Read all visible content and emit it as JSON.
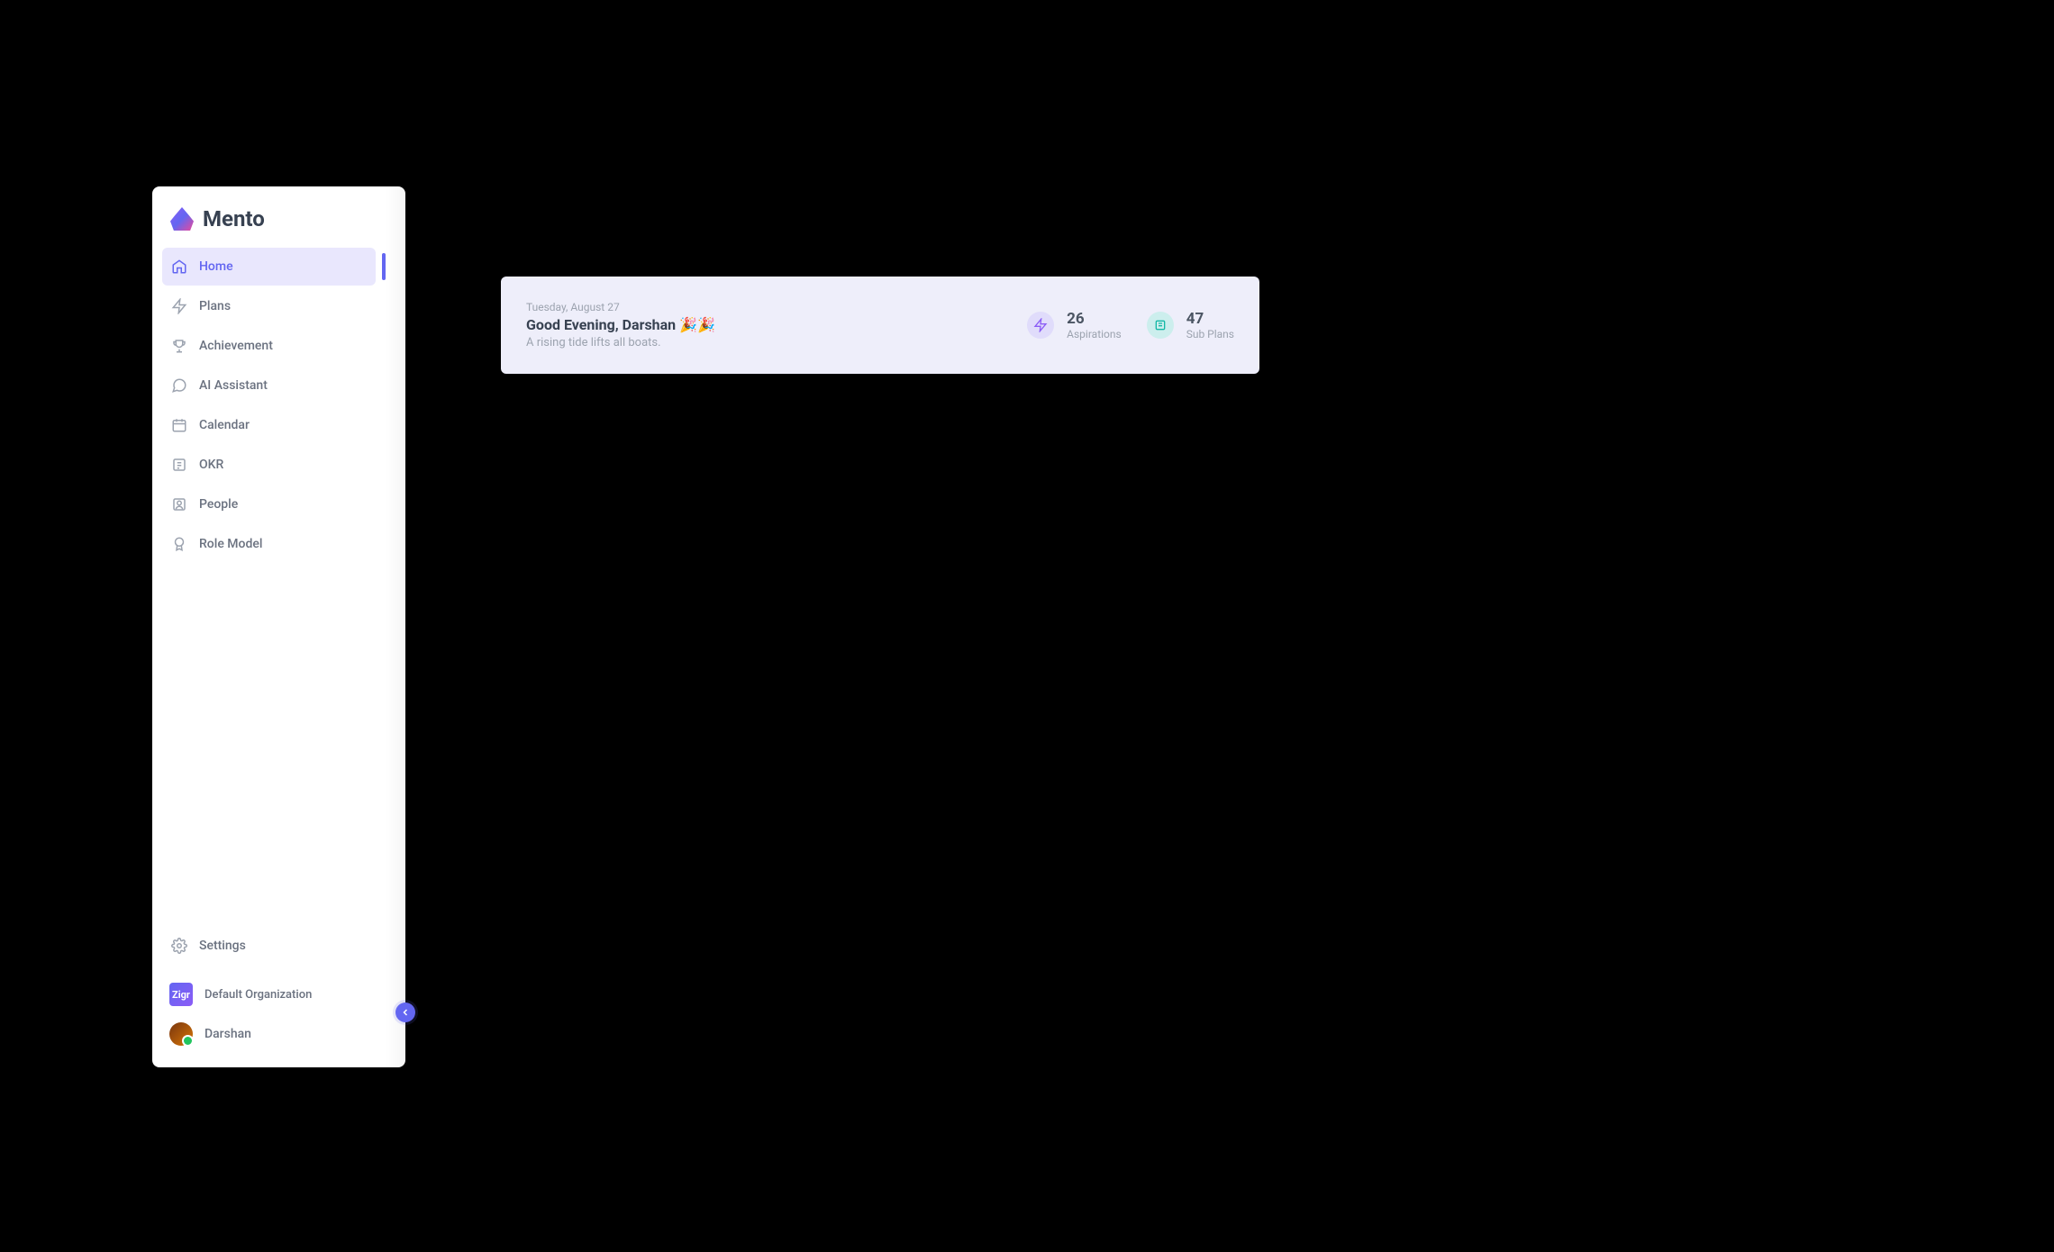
{
  "app": {
    "name": "Mento"
  },
  "sidebar": {
    "items": [
      {
        "label": "Home",
        "icon": "home"
      },
      {
        "label": "Plans",
        "icon": "zap"
      },
      {
        "label": "Achievement",
        "icon": "trophy"
      },
      {
        "label": "AI Assistant",
        "icon": "chat"
      },
      {
        "label": "Calendar",
        "icon": "calendar"
      },
      {
        "label": "OKR",
        "icon": "target"
      },
      {
        "label": "People",
        "icon": "user"
      },
      {
        "label": "Role Model",
        "icon": "badge"
      }
    ],
    "settings_label": "Settings",
    "org": {
      "logo_text": "Zigr",
      "label": "Default Organization"
    },
    "user": {
      "name": "Darshan"
    }
  },
  "header": {
    "date": "Tuesday, August 27",
    "greeting": "Good Evening, Darshan 🎉🎉",
    "quote": "A rising tide lifts all boats.",
    "stats": [
      {
        "value": "26",
        "label": "Aspirations"
      },
      {
        "value": "47",
        "label": "Sub Plans"
      }
    ]
  }
}
